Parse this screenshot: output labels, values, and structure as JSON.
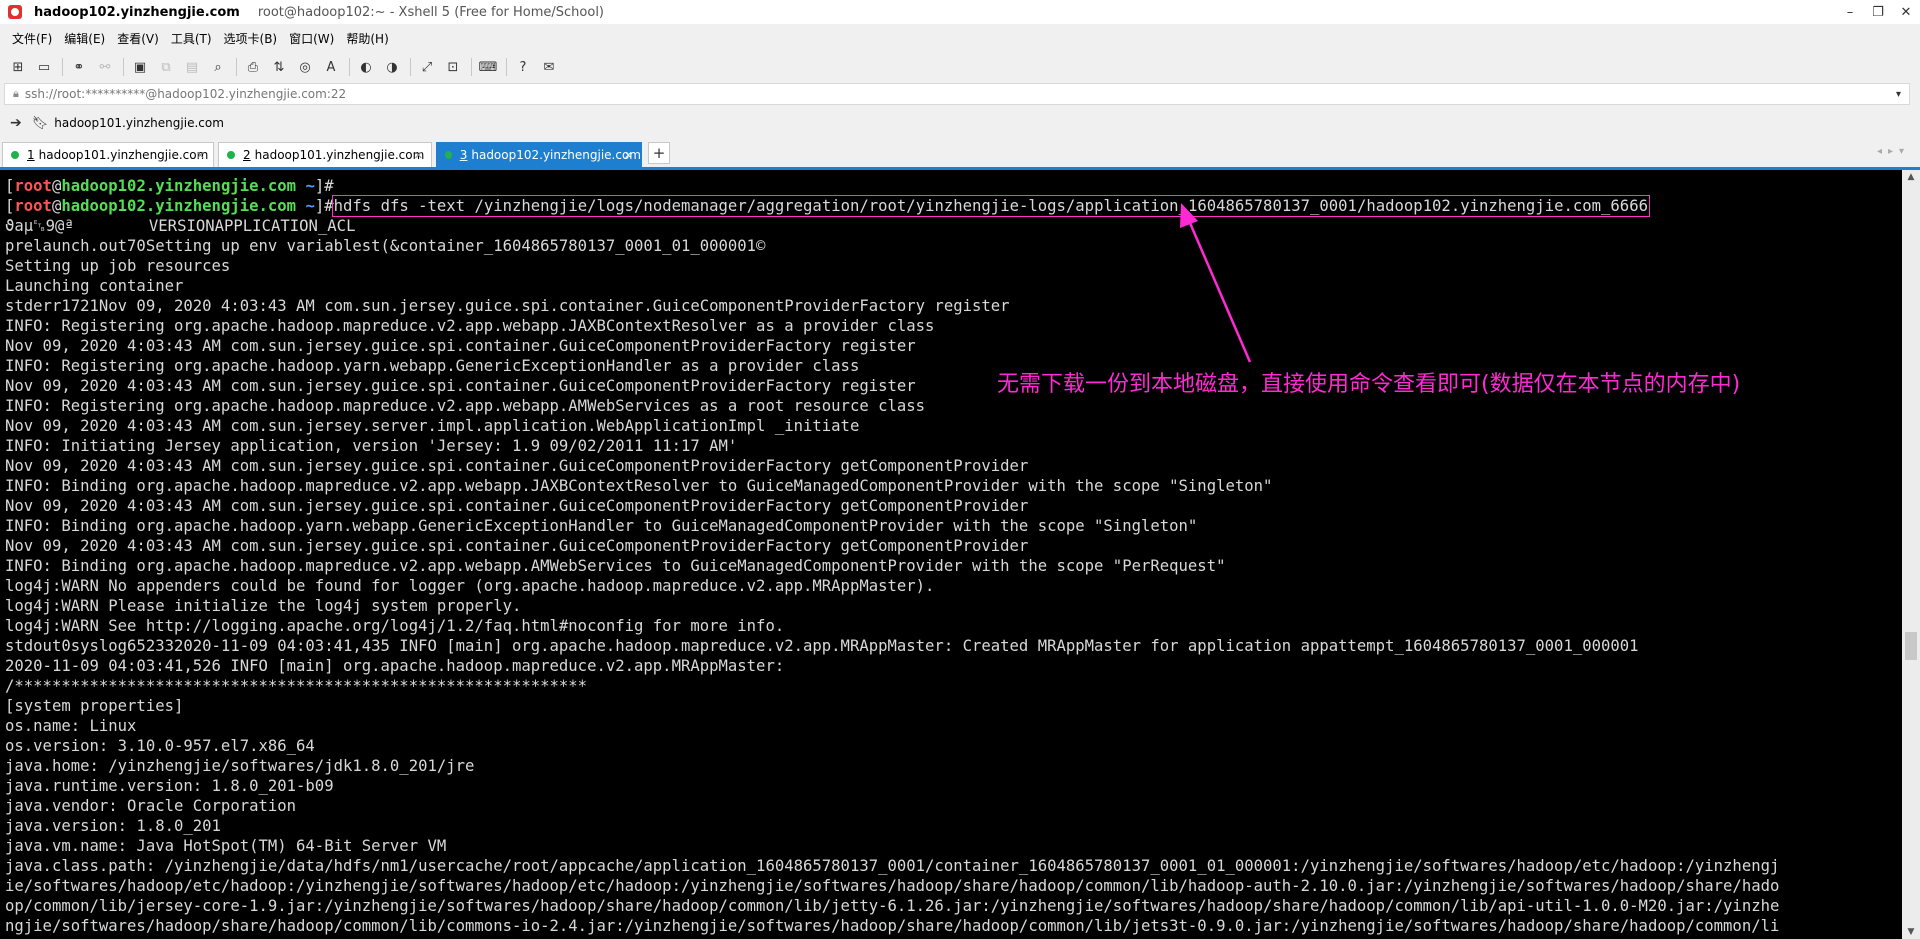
{
  "window": {
    "title_host": "hadoop102.yinzhengjie.com",
    "title_sub": "root@hadoop102:~ - Xshell 5 (Free for Home/School)",
    "logo_icon": "xshell-logo-icon",
    "controls": [
      "–",
      "❐",
      "✕"
    ]
  },
  "menu": [
    "文件(F)",
    "编辑(E)",
    "查看(V)",
    "工具(T)",
    "选项卡(B)",
    "窗口(W)",
    "帮助(H)"
  ],
  "toolbar_icons": [
    "new-session-icon",
    "open-folder-icon",
    "connect-icon",
    "disconnect-icon",
    "properties-icon",
    "copy-icon",
    "paste-icon",
    "find-icon",
    "print-icon",
    "transfer-icon",
    "globe-icon",
    "font-icon",
    "xftp-icon",
    "xftp2-icon",
    "fullscreen-icon",
    "lock-icon",
    "keyboard-icon",
    "help-icon",
    "chat-icon"
  ],
  "address": {
    "value": "ssh://root:**********@hadoop102.yinzhengjie.com:22"
  },
  "linkbar": {
    "bookmark_label": "hadoop101.yinzhengjie.com"
  },
  "tabs": [
    {
      "num": "1",
      "label": "hadoop101.yinzhengjie.com",
      "active": false
    },
    {
      "num": "2",
      "label": "hadoop101.yinzhengjie.com",
      "active": false
    },
    {
      "num": "3",
      "label": "hadoop102.yinzhengjie.com",
      "active": true
    }
  ],
  "terminal": {
    "prompt": {
      "open": "[",
      "user": "root",
      "at": "@",
      "host": "hadoop102.yinzhengjie.com",
      "dir": " ~",
      "close": "]#"
    },
    "command": "hdfs dfs -text /yinzhengjie/logs/nodemanager/aggregation/root/yinzhengjie-logs/application_1604865780137_0001/hadoop102.yinzhengjie.com_6666",
    "output": [
      "ϑaµ␗9@ª        VERSIONAPPLICATION_ACL",
      "prelaunch.out70Setting up env variablest(&container_1604865780137_0001_01_000001©",
      "Setting up job resources",
      "Launching container",
      "stderr1721Nov 09, 2020 4:03:43 AM com.sun.jersey.guice.spi.container.GuiceComponentProviderFactory register",
      "INFO: Registering org.apache.hadoop.mapreduce.v2.app.webapp.JAXBContextResolver as a provider class",
      "Nov 09, 2020 4:03:43 AM com.sun.jersey.guice.spi.container.GuiceComponentProviderFactory register",
      "INFO: Registering org.apache.hadoop.yarn.webapp.GenericExceptionHandler as a provider class",
      "Nov 09, 2020 4:03:43 AM com.sun.jersey.guice.spi.container.GuiceComponentProviderFactory register",
      "INFO: Registering org.apache.hadoop.mapreduce.v2.app.webapp.AMWebServices as a root resource class",
      "Nov 09, 2020 4:03:43 AM com.sun.jersey.server.impl.application.WebApplicationImpl _initiate",
      "INFO: Initiating Jersey application, version 'Jersey: 1.9 09/02/2011 11:17 AM'",
      "Nov 09, 2020 4:03:43 AM com.sun.jersey.guice.spi.container.GuiceComponentProviderFactory getComponentProvider",
      "INFO: Binding org.apache.hadoop.mapreduce.v2.app.webapp.JAXBContextResolver to GuiceManagedComponentProvider with the scope \"Singleton\"",
      "Nov 09, 2020 4:03:43 AM com.sun.jersey.guice.spi.container.GuiceComponentProviderFactory getComponentProvider",
      "INFO: Binding org.apache.hadoop.yarn.webapp.GenericExceptionHandler to GuiceManagedComponentProvider with the scope \"Singleton\"",
      "Nov 09, 2020 4:03:43 AM com.sun.jersey.guice.spi.container.GuiceComponentProviderFactory getComponentProvider",
      "INFO: Binding org.apache.hadoop.mapreduce.v2.app.webapp.AMWebServices to GuiceManagedComponentProvider with the scope \"PerRequest\"",
      "log4j:WARN No appenders could be found for logger (org.apache.hadoop.mapreduce.v2.app.MRAppMaster).",
      "log4j:WARN Please initialize the log4j system properly.",
      "log4j:WARN See http://logging.apache.org/log4j/1.2/faq.html#noconfig for more info.",
      "stdout0syslog652332020-11-09 04:03:41,435 INFO [main] org.apache.hadoop.mapreduce.v2.app.MRAppMaster: Created MRAppMaster for application appattempt_1604865780137_0001_000001",
      "2020-11-09 04:03:41,526 INFO [main] org.apache.hadoop.mapreduce.v2.app.MRAppMaster:",
      "/*************************************************************",
      "[system properties]",
      "os.name: Linux",
      "os.version: 3.10.0-957.el7.x86_64",
      "java.home: /yinzhengjie/softwares/jdk1.8.0_201/jre",
      "java.runtime.version: 1.8.0_201-b09",
      "java.vendor: Oracle Corporation",
      "java.version: 1.8.0_201",
      "java.vm.name: Java HotSpot(TM) 64-Bit Server VM",
      "java.class.path: /yinzhengjie/data/hdfs/nm1/usercache/root/appcache/application_1604865780137_0001/container_1604865780137_0001_01_000001:/yinzhengjie/softwares/hadoop/etc/hadoop:/yinzhengj",
      "ie/softwares/hadoop/etc/hadoop:/yinzhengjie/softwares/hadoop/etc/hadoop:/yinzhengjie/softwares/hadoop/share/hadoop/common/lib/hadoop-auth-2.10.0.jar:/yinzhengjie/softwares/hadoop/share/hado",
      "op/common/lib/jersey-core-1.9.jar:/yinzhengjie/softwares/hadoop/share/hadoop/common/lib/jetty-6.1.26.jar:/yinzhengjie/softwares/hadoop/share/hadoop/common/lib/api-util-1.0.0-M20.jar:/yinzhe",
      "ngjie/softwares/hadoop/share/hadoop/common/lib/commons-io-2.4.jar:/yinzhengjie/softwares/hadoop/share/hadoop/common/lib/jets3t-0.9.0.jar:/yinzhengjie/softwares/hadoop/share/hadoop/common/li"
    ]
  },
  "annotation": {
    "text": "无需下载一份到本地磁盘，直接使用命令查看即可(数据仅在本节点的内存中)",
    "color": "#ff2ad4"
  },
  "colors": {
    "prompt_user": "#ff5555",
    "prompt_host": "#55dd55",
    "prompt_dir": "#5599ff",
    "tab_active": "#1e7fd0",
    "terminal_bg": "#000000",
    "terminal_fg": "#d8d8d8"
  }
}
